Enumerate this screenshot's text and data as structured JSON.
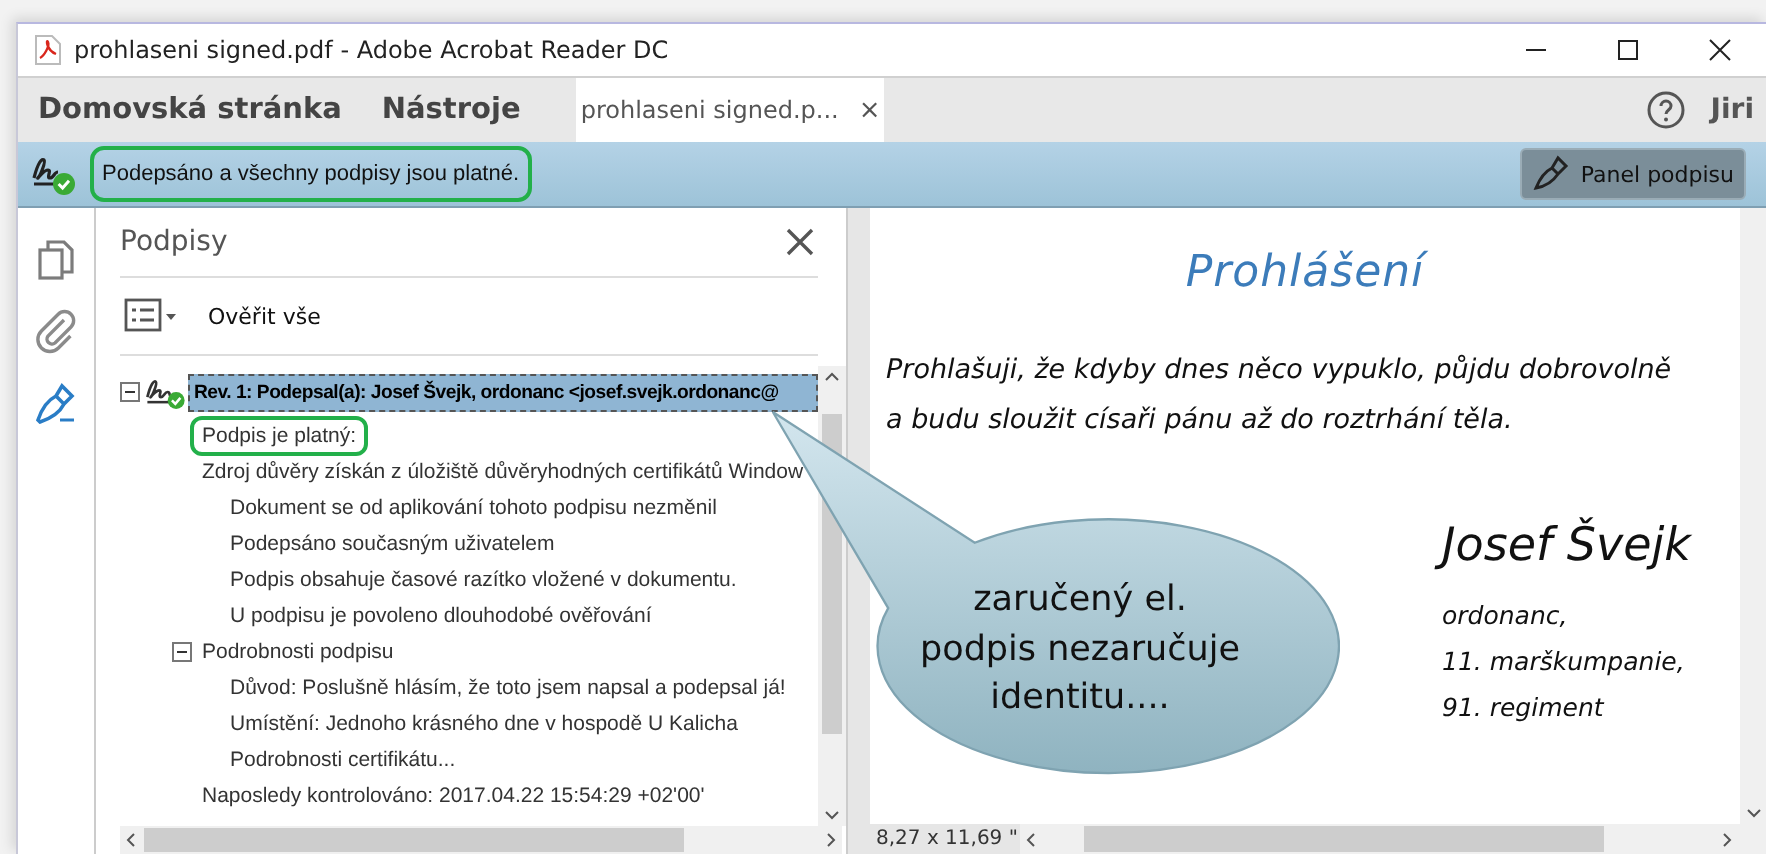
{
  "window": {
    "title": "prohlaseni signed.pdf - Adobe Acrobat Reader DC"
  },
  "menu": [
    {
      "label": "Domovská stránka"
    },
    {
      "label": "Nástroje"
    }
  ],
  "tabs": [
    {
      "label": "prohlaseni signed.p...",
      "close": "×",
      "selected": true
    }
  ],
  "user": {
    "name": "Jiri"
  },
  "banner": {
    "text": "Podepsáno a všechny podpisy jsou platné.",
    "outlined": true,
    "button": "Panel podpisu"
  },
  "rail": [
    {
      "kind": "pages",
      "selected": false
    },
    {
      "kind": "attachments",
      "selected": false
    },
    {
      "kind": "signatures",
      "selected": true
    }
  ],
  "panel": {
    "title": "Podpisy",
    "verify_all": "Ověřit vše",
    "tree": [
      {
        "text": "Rev. 1: Podepsal(a): Josef Švejk, ordonanc <josef.svejk.ordonanc@",
        "expanded": true,
        "selected": true,
        "outlined": false,
        "children": [
          {
            "text": "Podpis je platný:",
            "selected": false,
            "outlined": true
          },
          {
            "text": "Zdroj důvěry získán z úložiště důvěryhodných certifikátů Window",
            "selected": false,
            "outlined": false,
            "children": [
              {
                "text": "Dokument se od aplikování tohoto podpisu nezměnil",
                "selected": false,
                "outlined": false
              },
              {
                "text": "Podepsáno současným uživatelem",
                "selected": false,
                "outlined": false
              },
              {
                "text": "Podpis obsahuje časové razítko vložené v dokumentu.",
                "selected": false,
                "outlined": false
              },
              {
                "text": "U podpisu je povoleno dlouhodobé ověřování",
                "selected": false,
                "outlined": false
              }
            ]
          },
          {
            "text": "Podrobnosti podpisu",
            "expanded": true,
            "selected": false,
            "outlined": false,
            "children": [
              {
                "text": "Důvod: Poslušně hlásím, že toto jsem napsal a podepsal já!",
                "selected": false,
                "outlined": false
              },
              {
                "text": "Umístění: Jednoho krásného dne v hospodě U Kalicha",
                "selected": false,
                "outlined": false
              },
              {
                "text": "Podrobnosti certifikátu...",
                "selected": false,
                "outlined": false
              }
            ]
          },
          {
            "text": "Naposledy kontrolováno: 2017.04.22 15:54:29 +02'00'",
            "selected": false,
            "outlined": false
          }
        ]
      }
    ]
  },
  "document": {
    "title": "Prohlášení",
    "paragraph": [
      "Prohlašuji, že kdyby dnes něco vypuklo, půjdu dobrovolně",
      "a budu sloužit císaři pánu až do roztrhání těla."
    ],
    "signature_name": "Josef Švejk",
    "signature_lines": [
      "ordonanc,",
      "11. marškumpanie,",
      "91. regiment"
    ],
    "page_size": "8,27 x 11,69 \""
  },
  "callout": {
    "text": "zaručený el.\npodpis nezaručuje\nidentitu...."
  }
}
